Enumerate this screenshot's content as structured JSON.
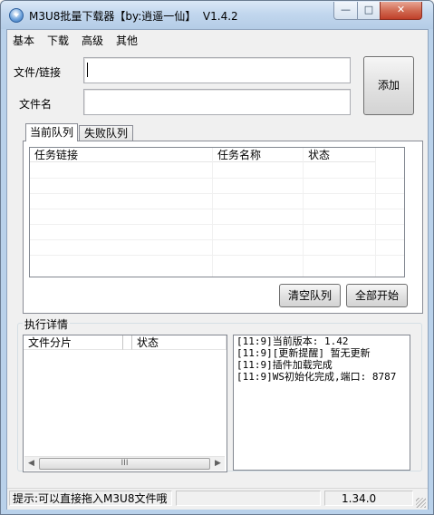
{
  "window": {
    "title": "M3U8批量下载器【by:逍遥一仙】  V1.4.2",
    "controls": {
      "minimize": "—",
      "maximize": "□",
      "close": "✕"
    }
  },
  "menu": {
    "items": [
      {
        "label": "基本"
      },
      {
        "label": "下载"
      },
      {
        "label": "高级"
      },
      {
        "label": "其他"
      }
    ]
  },
  "form": {
    "url_label": "文件/链接",
    "url_value": "",
    "filename_label": "文件名",
    "filename_value": "",
    "add_button": "添加"
  },
  "queue_tabs": [
    {
      "label": "当前队列",
      "active": true
    },
    {
      "label": "失败队列",
      "active": false
    }
  ],
  "queue_table": {
    "columns": [
      "任务链接",
      "任务名称",
      "状态"
    ],
    "rows": []
  },
  "queue_buttons": {
    "clear": "清空队列",
    "start_all": "全部开始"
  },
  "details": {
    "group_title": "执行详情",
    "columns": [
      "文件分片",
      "状态"
    ],
    "scroll_thumb_glyph": "III",
    "log_lines": [
      "[11:9]当前版本: 1.42",
      "[11:9][更新提醒] 暂无更新",
      "[11:9]插件加载完成",
      "[11:9]WS初始化完成,端口: 8787"
    ]
  },
  "status": {
    "hint": "提示:可以直接拖入M3U8文件哦",
    "version": "1.34.0"
  },
  "colors": {
    "titlebar": "#c2d7ee",
    "client_bg": "#f0f0f0",
    "close_button": "#c0402a"
  }
}
